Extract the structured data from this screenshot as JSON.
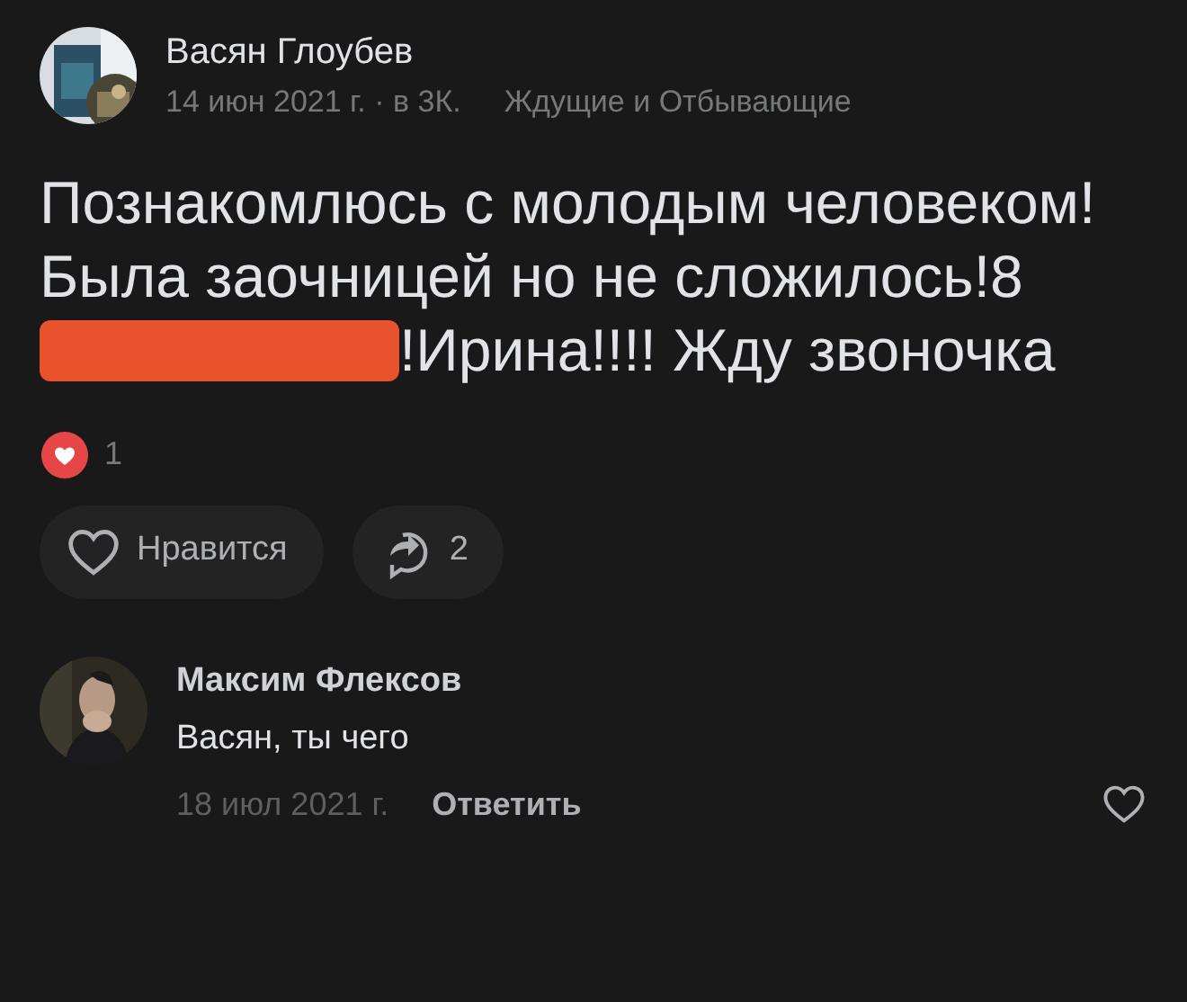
{
  "post": {
    "author": "Васян Глоубев",
    "date": "14 июн 2021 г. · в 3К.",
    "group": "Ждущие и Отбывающие",
    "text_before": "Познакомлюсь с молодым человеком!Была заочницей но не сложилось!8",
    "redacted": true,
    "text_after": "!Ирина!!!! Жду звоночка",
    "reactions_count": "1",
    "like_button": {
      "label": "Нравится",
      "liked": false
    },
    "share_button": {
      "count": "2"
    }
  },
  "comments": [
    {
      "author": "Максим Флексов",
      "text": "Васян, ты чего",
      "date": "18 июл 2021 г.",
      "reply": "Ответить",
      "liked": false
    }
  ]
}
